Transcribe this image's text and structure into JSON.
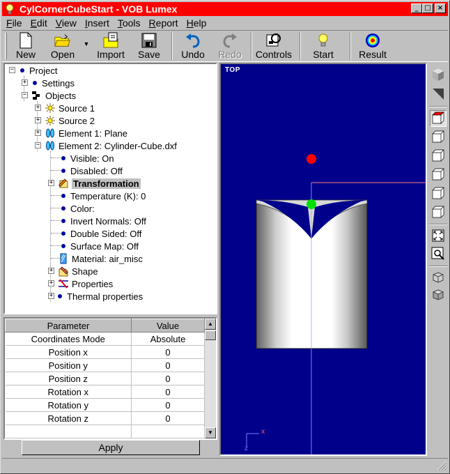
{
  "window": {
    "title": "CylCornerCubeStart - VOB Lumex"
  },
  "menu": [
    {
      "label": "File",
      "accel": "F",
      "rest": "ile"
    },
    {
      "label": "Edit",
      "accel": "E",
      "rest": "dit"
    },
    {
      "label": "View",
      "accel": "V",
      "rest": "iew"
    },
    {
      "label": "Insert",
      "accel": "I",
      "rest": "nsert"
    },
    {
      "label": "Tools",
      "accel": "T",
      "rest": "ools"
    },
    {
      "label": "Report",
      "accel": "R",
      "rest": "eport"
    },
    {
      "label": "Help",
      "accel": "H",
      "rest": "elp"
    }
  ],
  "toolbar": {
    "new": "New",
    "open": "Open",
    "import": "Import",
    "save": "Save",
    "undo": "Undo",
    "redo": "Redo",
    "controls": "Controls",
    "start": "Start",
    "result": "Result"
  },
  "tree": {
    "project": "Project",
    "settings": "Settings",
    "objects": "Objects",
    "source1": "Source 1",
    "source2": "Source 2",
    "element1": "Element 1: Plane",
    "element2": "Element 2: Cylinder-Cube.dxf",
    "visible": "Visible: On",
    "disabled": "Disabled: Off",
    "transformation": "Transformation",
    "temperature": "Temperature (K): 0",
    "color": "Color:",
    "invert_normals": "Invert Normals: Off",
    "double_sided": "Double Sided: Off",
    "surface_map": "Surface Map: Off",
    "material": "Material: air_misc",
    "shape": "Shape",
    "properties": "Properties",
    "thermal": "Thermal properties"
  },
  "params": {
    "header_param": "Parameter",
    "header_value": "Value",
    "rows": [
      {
        "name": "Coordinates Mode",
        "value": "Absolute"
      },
      {
        "name": "Position x",
        "value": "0"
      },
      {
        "name": "Position y",
        "value": "0"
      },
      {
        "name": "Position z",
        "value": "0"
      },
      {
        "name": "Rotation x",
        "value": "0"
      },
      {
        "name": "Rotation y",
        "value": "0"
      },
      {
        "name": "Rotation z",
        "value": "0"
      }
    ],
    "apply": "Apply"
  },
  "viewport": {
    "label": "TOP",
    "axis_x": "x",
    "axis_z": "z"
  }
}
